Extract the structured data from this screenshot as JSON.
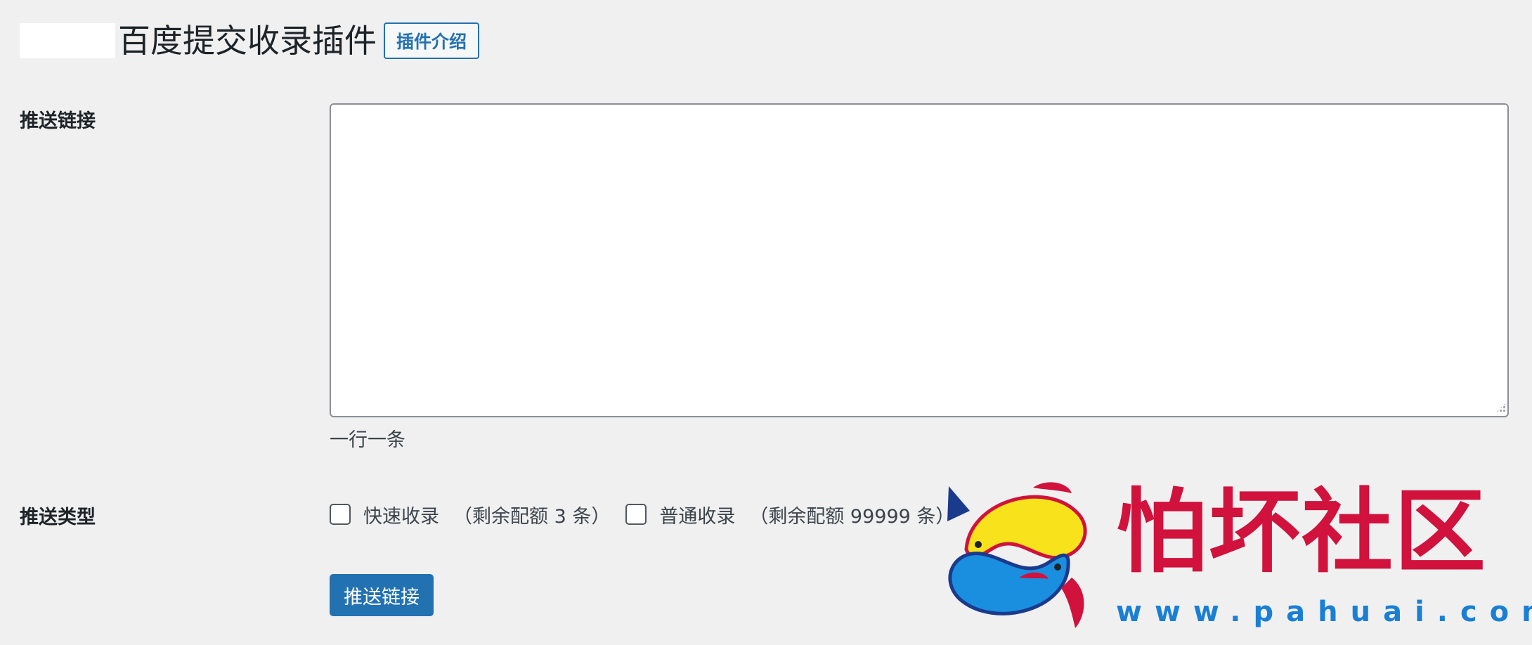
{
  "header": {
    "title": "百度提交收录插件",
    "intro_button": "插件介绍"
  },
  "form": {
    "links_label": "推送链接",
    "links_value": "",
    "links_description": "一行一条",
    "type_label": "推送类型",
    "options": [
      {
        "label": "快速收录",
        "note": "（剩余配额 3 条）",
        "checked": false
      },
      {
        "label": "普通收录",
        "note": "（剩余配额 99999 条）",
        "checked": false
      }
    ],
    "submit_label": "推送链接"
  },
  "watermark": {
    "text": "怕坏社区",
    "url": "www.pahuai.com",
    "colors": {
      "text": "#d0123c",
      "url": "#1a7fd4",
      "fish_yellow": "#f7e21b",
      "fish_blue": "#1a8fe0"
    }
  },
  "colors": {
    "background": "#f0f0f1",
    "accent": "#2271b1"
  }
}
